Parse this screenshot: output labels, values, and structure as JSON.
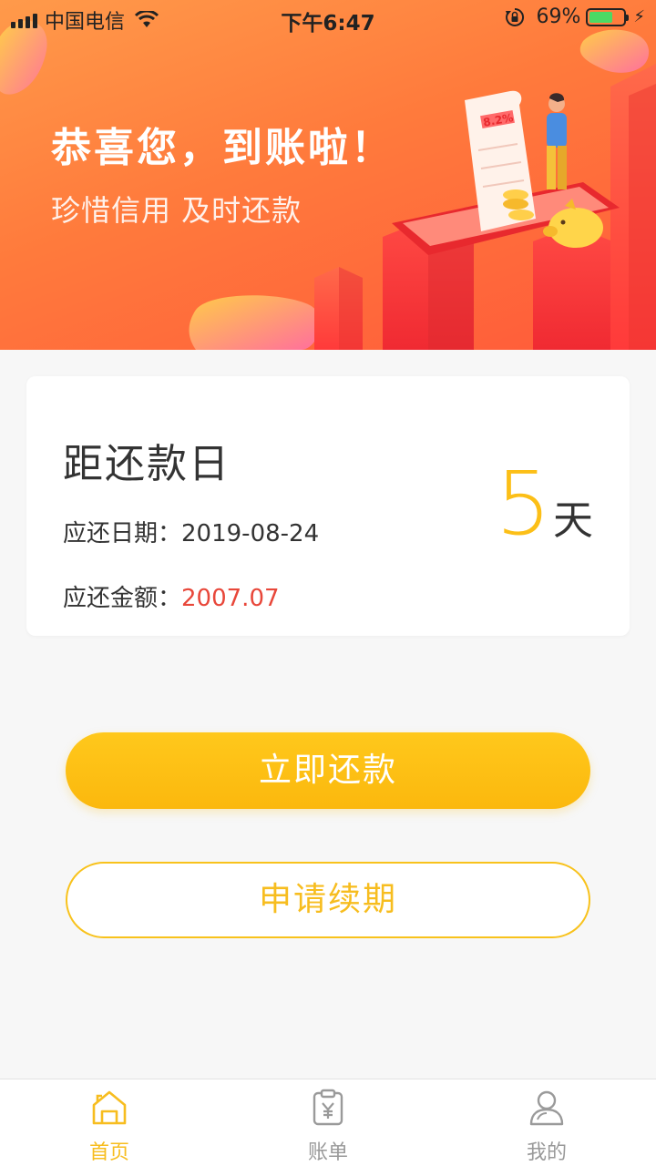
{
  "status_bar": {
    "carrier": "中国电信",
    "time": "下午6:47",
    "battery_percent": "69%",
    "battery_level": 0.69
  },
  "hero": {
    "title": "恭喜您，到账啦！",
    "subtitle": "珍惜信用 及时还款",
    "illustration_text": "8.2%"
  },
  "card": {
    "title": "距还款日",
    "due_date_label": "应还日期：",
    "due_date_value": "2019-08-24",
    "amount_label": "应还金额：",
    "amount_value": "2007.07",
    "days_number": "5",
    "days_unit": "天"
  },
  "buttons": {
    "repay_now": "立即还款",
    "apply_extension": "申请续期"
  },
  "tabbar": {
    "items": [
      {
        "label": "首页",
        "icon": "home-icon",
        "active": true
      },
      {
        "label": "账单",
        "icon": "bill-icon",
        "active": false
      },
      {
        "label": "我的",
        "icon": "profile-icon",
        "active": false
      }
    ]
  },
  "colors": {
    "accent": "#fcbf17",
    "amount_red": "#e8473a",
    "hero_orange": "#ff7a3c"
  }
}
